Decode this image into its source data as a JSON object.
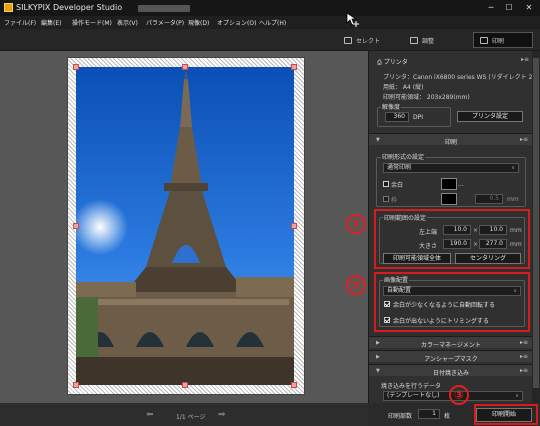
{
  "window": {
    "title": "SILKYPIX Developer Studio",
    "minimize": "─",
    "maximize": "☐",
    "close": "✕"
  },
  "menu": [
    "ファイル(F)",
    "編集(E)",
    "操作モード(M)",
    "表示(V)",
    "パラメータ(P)",
    "現像(D)",
    "オプション(O)",
    "ヘルプ(H)"
  ],
  "modes": {
    "select": "セレクト",
    "adjust": "調整",
    "print": "印刷"
  },
  "printer": {
    "header": "プリンタ",
    "printer_line": "プリンタ：Canon iX6800 series WS (リダイレクト 2)",
    "paper_line": "用紙： A4 (縦)",
    "area_line": "印刷可能領域： 203x289(mm)",
    "resolution_label": "解像度",
    "resolution_value": "360",
    "resolution_unit": "DPI",
    "settings_button": "プリンタ設定"
  },
  "print_section": {
    "header": "印刷",
    "format_group": "印刷形式の設定",
    "format_value": "通常印刷",
    "margin_label": "余白",
    "frame_label": "枠",
    "frame_value": "0.5",
    "frame_unit": "mm",
    "area_group": "印刷範囲の設定",
    "topleft_label": "左上端",
    "topleft_x": "10.0",
    "topleft_y": "10.0",
    "size_label": "大きさ",
    "size_w": "190.0",
    "size_h": "277.0",
    "times": "×",
    "unit": "mm",
    "whole_button": "印刷可能領域全体",
    "center_button": "センタリング",
    "layout_group": "画像配置",
    "layout_value": "自動配置",
    "auto_rotate_label": "余白が少なくなるように自動回転する",
    "auto_rotate_checked": true,
    "trim_label": "余白が出ないようにトリミングする",
    "trim_checked": true
  },
  "collapsed": {
    "color_mgmt": "カラーマネージメント",
    "unsharp": "アンシャープマスク",
    "date_print": "日付焼き込み"
  },
  "date_print": {
    "group": "焼き込みを行うデータ",
    "value": "(テンプレートなし)"
  },
  "annotations": {
    "c1": "①",
    "c2": "②",
    "c3": "③"
  },
  "pager": {
    "page_text": "1/1 ページ"
  },
  "bottom": {
    "copies_label": "印刷部数",
    "copies_value": "1",
    "copies_unit": "枚",
    "start_button": "印刷開始"
  },
  "colors": {
    "accent_red": "#d81b1b",
    "dark_bg": "#2b2b2b",
    "panel_bg": "#303030"
  }
}
